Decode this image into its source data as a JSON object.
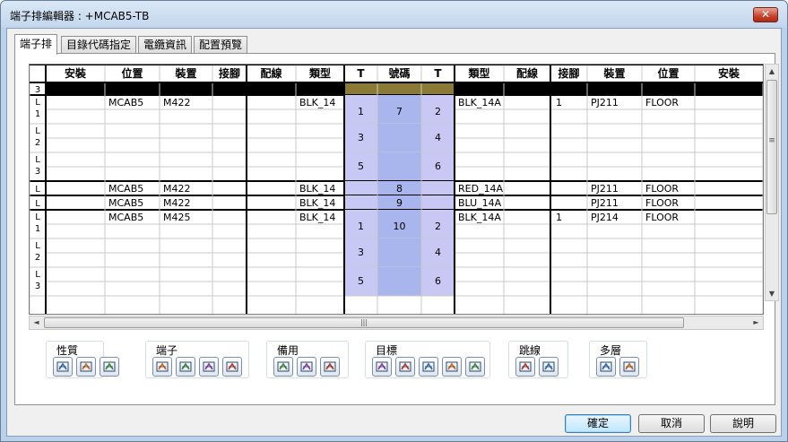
{
  "window": {
    "title": "端子排編輯器 : +MCAB5-TB",
    "close_glyph": "✕"
  },
  "tabs": [
    {
      "label": "端子排"
    },
    {
      "label": "目錄代碼指定"
    },
    {
      "label": "電纜資訊"
    },
    {
      "label": "配置預覽"
    }
  ],
  "table": {
    "headers": [
      "",
      "安裝",
      "位置",
      "裝置",
      "接腳",
      "配線",
      "類型",
      "T",
      "號碼",
      "T",
      "類型",
      "配線",
      "接腳",
      "裝置",
      "位置",
      "安裝"
    ],
    "colors": {
      "black_row": "#000000",
      "olive_cell": "#8b7a35",
      "lav_a": "#c8c8f4",
      "lav_b": "#a9b6ee",
      "lav_c": "#c9c7f3",
      "grid_line": "#c8c8c8"
    },
    "groups": [
      {
        "marker": "3",
        "kind": "separator"
      },
      {
        "marker": "L 1",
        "kind": "multi",
        "left": {
          "loc": "MCAB5",
          "dev": "M422",
          "type": "BLK_14"
        },
        "right": {
          "type": "BLK_14A",
          "pin": "1",
          "dev": "PJ211",
          "loc": "FLOOR"
        },
        "number": "7",
        "t_left": "1",
        "t_right": "2"
      },
      {
        "marker": "L 2",
        "kind": "sub",
        "t_left": "3",
        "t_right": "4"
      },
      {
        "marker": "L 3",
        "kind": "sub",
        "t_left": "5",
        "t_right": "6"
      },
      {
        "marker": "L",
        "kind": "single",
        "left": {
          "loc": "MCAB5",
          "dev": "M422",
          "type": "BLK_14"
        },
        "right": {
          "type": "RED_14A",
          "dev": "PJ211",
          "loc": "FLOOR"
        },
        "number": "8"
      },
      {
        "marker": "L",
        "kind": "single",
        "left": {
          "loc": "MCAB5",
          "dev": "M422",
          "type": "BLK_14"
        },
        "right": {
          "type": "BLU_14A",
          "dev": "PJ211",
          "loc": "FLOOR"
        },
        "number": "9"
      },
      {
        "marker": "L 1",
        "kind": "multi",
        "left": {
          "loc": "MCAB5",
          "dev": "M425",
          "type": "BLK_14"
        },
        "right": {
          "type": "BLK_14A",
          "pin": "1",
          "dev": "PJ214",
          "loc": "FLOOR"
        },
        "number": "10",
        "t_left": "1",
        "t_right": "2"
      },
      {
        "marker": "L 2",
        "kind": "sub",
        "t_left": "3",
        "t_right": "4"
      },
      {
        "marker": "L 3",
        "kind": "sub",
        "t_left": "5",
        "t_right": "6"
      }
    ]
  },
  "scrollbars": {
    "thumb_grip": "|||",
    "up": "▲",
    "down": "▼",
    "left": "◄",
    "right": "►",
    "vgrip": "≡"
  },
  "toolbar_groups": [
    {
      "label": "性質",
      "tools": [
        "edit-properties-icon",
        "copy-properties-icon",
        "paste-properties-icon"
      ]
    },
    {
      "label": "端子",
      "tools": [
        "edit-terminal-icon",
        "rotate-terminal-icon",
        "insert-terminal-icon",
        "move-terminal-icon"
      ]
    },
    {
      "label": "備用",
      "tools": [
        "spare-add-icon",
        "spare-remove-icon",
        "spare-move-icon"
      ]
    },
    {
      "label": "目標",
      "tools": [
        "target-first-icon",
        "target-up-icon",
        "target-down-icon",
        "target-last-icon",
        "target-link-icon"
      ]
    },
    {
      "label": "跳線",
      "tools": [
        "jumper-add-icon",
        "jumper-edit-icon"
      ]
    },
    {
      "label": "多層",
      "tools": [
        "layer-split-icon",
        "layer-merge-icon"
      ]
    }
  ],
  "buttons": {
    "ok": "確定",
    "cancel": "取消",
    "help": "說明"
  }
}
